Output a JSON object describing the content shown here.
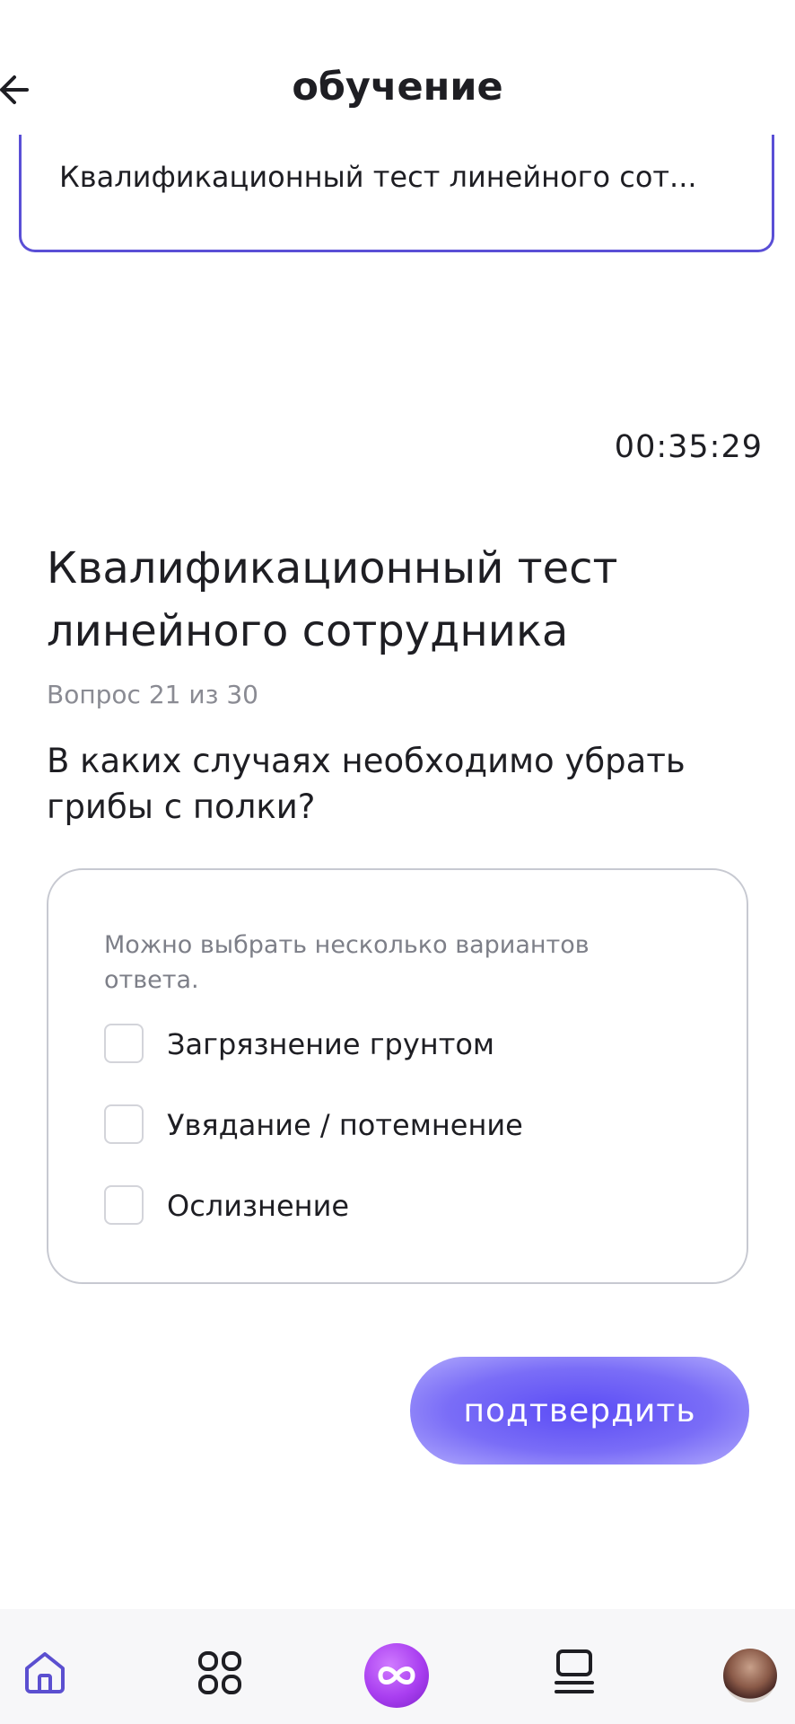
{
  "header": {
    "title": "обучение"
  },
  "selector": {
    "text": "Квалификационный тест линейного сот..."
  },
  "timer": "00:35:29",
  "test": {
    "title": "Квалификационный тест линейного сотрудника",
    "counter": "Вопрос 21 из 30",
    "question": "В каких случаях необходимо убрать грибы с полки?"
  },
  "answers": {
    "hint": "Можно выбрать несколько вариантов ответа.",
    "options": [
      {
        "label": "Загрязнение грунтом",
        "checked": false
      },
      {
        "label": "Увядание / потемнение",
        "checked": false
      },
      {
        "label": "Ослизнение",
        "checked": false
      }
    ]
  },
  "confirm": {
    "label": "подтвердить"
  },
  "colors": {
    "accent": "#5a4fd6",
    "button": "#6a5cf6",
    "nav_active": "#5b4fd0",
    "center": "#a93ef0"
  },
  "nav": {
    "items": [
      {
        "icon": "home-icon",
        "active": true
      },
      {
        "icon": "grid-icon",
        "active": false
      },
      {
        "icon": "infinity-icon",
        "active": false
      },
      {
        "icon": "courses-icon",
        "active": false
      },
      {
        "icon": "avatar",
        "active": false
      }
    ]
  }
}
